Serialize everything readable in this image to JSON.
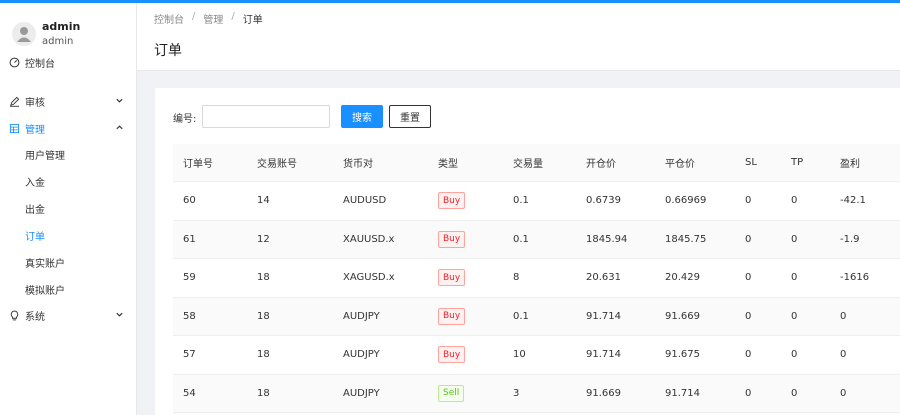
{
  "user": {
    "name": "admin",
    "role": "admin"
  },
  "sidebar": {
    "items": [
      {
        "label": "控制台",
        "icon": "dashboard-icon"
      },
      {
        "label": "审核",
        "icon": "edit-icon"
      },
      {
        "label": "管理",
        "icon": "table-icon"
      },
      {
        "label": "系统",
        "icon": "bulb-icon"
      }
    ],
    "sub_items": [
      "用户管理",
      "入金",
      "出金",
      "订单",
      "真实账户",
      "模拟账户"
    ]
  },
  "breadcrumb": [
    "控制台",
    "管理",
    "订单"
  ],
  "page_title": "订单",
  "search": {
    "label": "编号:",
    "value": "",
    "placeholder": ""
  },
  "buttons": {
    "search": "搜索",
    "reset": "重置"
  },
  "table": {
    "headers": [
      "订单号",
      "交易账号",
      "货币对",
      "类型",
      "交易量",
      "开仓价",
      "平仓价",
      "SL",
      "TP",
      "盈利"
    ],
    "rows": [
      [
        "60",
        "14",
        "AUDUSD",
        "Buy",
        "0.1",
        "0.6739",
        "0.66969",
        "0",
        "0",
        "-42.1"
      ],
      [
        "61",
        "12",
        "XAUUSD.x",
        "Buy",
        "0.1",
        "1845.94",
        "1845.75",
        "0",
        "0",
        "-1.9"
      ],
      [
        "59",
        "18",
        "XAGUSD.x",
        "Buy",
        "8",
        "20.631",
        "20.429",
        "0",
        "0",
        "-1616"
      ],
      [
        "58",
        "18",
        "AUDJPY",
        "Buy",
        "0.1",
        "91.714",
        "91.669",
        "0",
        "0",
        "0"
      ],
      [
        "57",
        "18",
        "AUDJPY",
        "Buy",
        "10",
        "91.714",
        "91.675",
        "0",
        "0",
        "0"
      ],
      [
        "54",
        "18",
        "AUDJPY",
        "Sell",
        "3",
        "91.669",
        "91.714",
        "0",
        "0",
        "0"
      ]
    ]
  },
  "colors": {
    "accent": "#1890ff",
    "buy": "#f5222d",
    "sell": "#52c41a"
  }
}
